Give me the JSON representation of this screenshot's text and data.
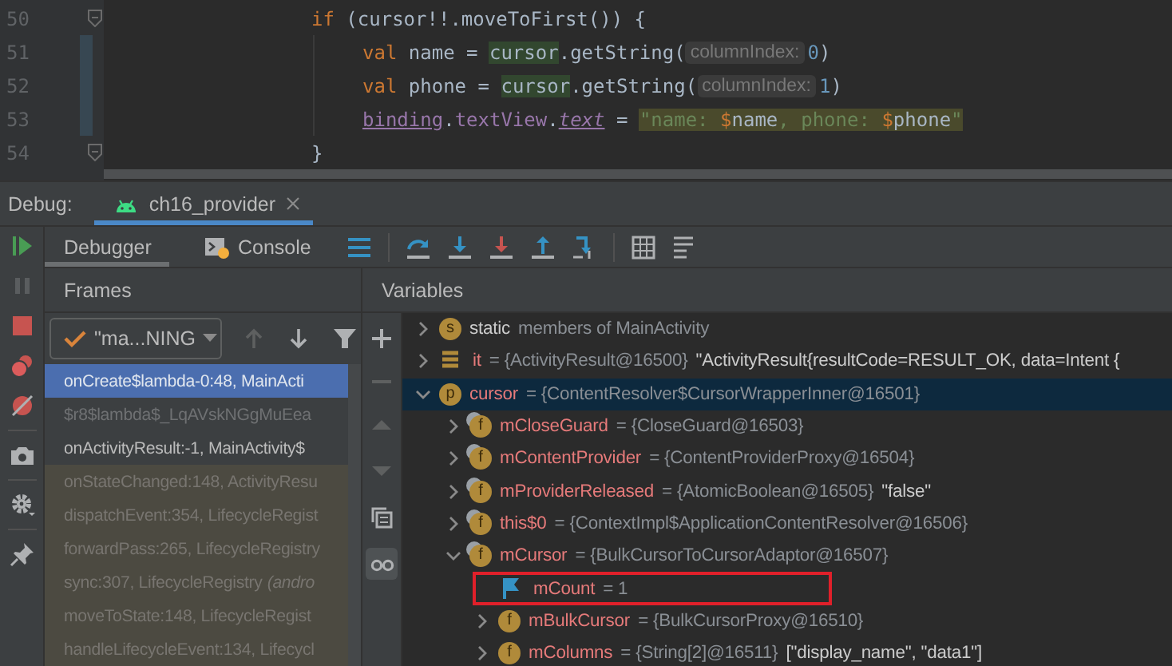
{
  "editor": {
    "lines": [
      {
        "number": "50",
        "fold": true,
        "tokens": [
          {
            "kind": "kw",
            "text": "if"
          },
          {
            "kind": "plain",
            "text": " (cursor!!.moveToFirst()) {"
          }
        ],
        "children": [
          {
            "number": "51",
            "changed": true,
            "tokens": [
              {
                "kind": "kw",
                "text": "val"
              },
              {
                "kind": "plain",
                "text": " name = "
              },
              {
                "kind": "smart",
                "text": "cursor"
              },
              {
                "kind": "plain",
                "text": ".getString("
              },
              {
                "kind": "hint",
                "text": "columnIndex:"
              },
              {
                "kind": "num",
                "text": "0"
              },
              {
                "kind": "plain",
                "text": ")"
              }
            ]
          },
          {
            "number": "52",
            "changed": true,
            "tokens": [
              {
                "kind": "kw",
                "text": "val"
              },
              {
                "kind": "plain",
                "text": " phone = "
              },
              {
                "kind": "smart",
                "text": "cursor"
              },
              {
                "kind": "plain",
                "text": ".getString("
              },
              {
                "kind": "hint",
                "text": "columnIndex:"
              },
              {
                "kind": "num",
                "text": "1"
              },
              {
                "kind": "plain",
                "text": ")"
              }
            ]
          },
          {
            "number": "53",
            "changed": true,
            "tokens": [
              {
                "kind": "prop-u",
                "text": "binding"
              },
              {
                "kind": "plain",
                "text": "."
              },
              {
                "kind": "prop",
                "text": "textView"
              },
              {
                "kind": "plain",
                "text": "."
              },
              {
                "kind": "prop-iu",
                "text": "text"
              },
              {
                "kind": "plain",
                "text": " = "
              },
              {
                "kind": "str-hl",
                "text": "\"name: "
              },
              {
                "kind": "dollar-hl",
                "text": "$"
              },
              {
                "kind": "plain-hl",
                "text": "name"
              },
              {
                "kind": "str-hl",
                "text": ", phone: "
              },
              {
                "kind": "dollar-hl",
                "text": "$"
              },
              {
                "kind": "plain-hl",
                "text": "phone"
              },
              {
                "kind": "str-hl",
                "text": "\""
              }
            ]
          }
        ]
      },
      {
        "number": "54",
        "fold": true,
        "tokens": [
          {
            "kind": "plain",
            "text": "}"
          }
        ]
      }
    ]
  },
  "debug_bar": {
    "label": "Debug:",
    "sessions": [
      {
        "label": "ch16_provider",
        "selected": true
      }
    ]
  },
  "tabs": [
    {
      "label": "Debugger",
      "selected": true
    },
    {
      "label": "Console",
      "selected": false
    }
  ],
  "frames": {
    "title": "Frames",
    "thread": "\"ma...NING",
    "items": [
      {
        "text": "onCreate$lambda-0:48, MainActi",
        "kind": "app",
        "selected": true
      },
      {
        "text": "$r8$lambda$_LqAVskNGgMuEea",
        "kind": "synthetic",
        "selected": false
      },
      {
        "text": "onActivityResult:-1, MainActivity$",
        "kind": "app",
        "selected": false
      },
      {
        "text": "onStateChanged:148, ActivityResu",
        "kind": "library",
        "selected": false
      },
      {
        "text": "dispatchEvent:354, LifecycleRegist",
        "kind": "library",
        "selected": false
      },
      {
        "text": "forwardPass:265, LifecycleRegistry",
        "kind": "library",
        "selected": false
      },
      {
        "text": "sync:307, LifecycleRegistry",
        "note": "(andro",
        "kind": "library",
        "selected": false
      },
      {
        "text": "moveToState:148, LifecycleRegist",
        "kind": "library",
        "selected": false
      },
      {
        "text": "handleLifecycleEvent:134, Lifecycl",
        "kind": "library",
        "selected": false
      }
    ]
  },
  "variables": {
    "title": "Variables",
    "items": [
      {
        "kind": "static",
        "badge": "s",
        "name": "static",
        "value": "members of MainActivity",
        "expanded": false,
        "selected": false,
        "outlined": false
      },
      {
        "kind": "list",
        "name": "it",
        "value": "= {ActivityResult@16500}",
        "extra": "\"ActivityResult{resultCode=RESULT_OK, data=Intent {",
        "expanded": false,
        "selected": false,
        "outlined": false
      },
      {
        "kind": "param",
        "badge": "p",
        "name": "cursor",
        "value": "= {ContentResolver$CursorWrapperInner@16501}",
        "expanded": true,
        "selected": true,
        "outlined": false,
        "children": [
          {
            "kind": "field",
            "badge": "f",
            "name": "mCloseGuard",
            "value": "= {CloseGuard@16503}",
            "expanded": false,
            "selected": false,
            "outlined": false
          },
          {
            "kind": "field",
            "badge": "f",
            "name": "mContentProvider",
            "value": "= {ContentProviderProxy@16504}",
            "expanded": false,
            "selected": false,
            "outlined": false
          },
          {
            "kind": "field",
            "badge": "f",
            "name": "mProviderReleased",
            "value": "= {AtomicBoolean@16505}",
            "extra": "\"false\"",
            "expanded": false,
            "selected": false,
            "outlined": false
          },
          {
            "kind": "field",
            "badge": "f",
            "name": "this$0",
            "value": "= {ContextImpl$ApplicationContentResolver@16506}",
            "expanded": false,
            "selected": false,
            "outlined": false
          },
          {
            "kind": "field",
            "badge": "f",
            "name": "mCursor",
            "value": "= {BulkCursorToCursorAdaptor@16507}",
            "expanded": true,
            "selected": false,
            "outlined": false,
            "children": [
              {
                "kind": "flag",
                "name": "mCount",
                "value": "= 1",
                "selected": false,
                "outlined": true
              },
              {
                "kind": "field-plain",
                "badge": "f",
                "name": "mBulkCursor",
                "value": "= {BulkCursorProxy@16510}",
                "expanded": false,
                "selected": false,
                "outlined": false
              },
              {
                "kind": "field-plain",
                "badge": "f",
                "name": "mColumns",
                "value": "= {String[2]@16511}",
                "extra": "[\"display_name\", \"data1\"]",
                "expanded": false,
                "selected": false,
                "outlined": false
              }
            ]
          }
        ]
      }
    ]
  }
}
